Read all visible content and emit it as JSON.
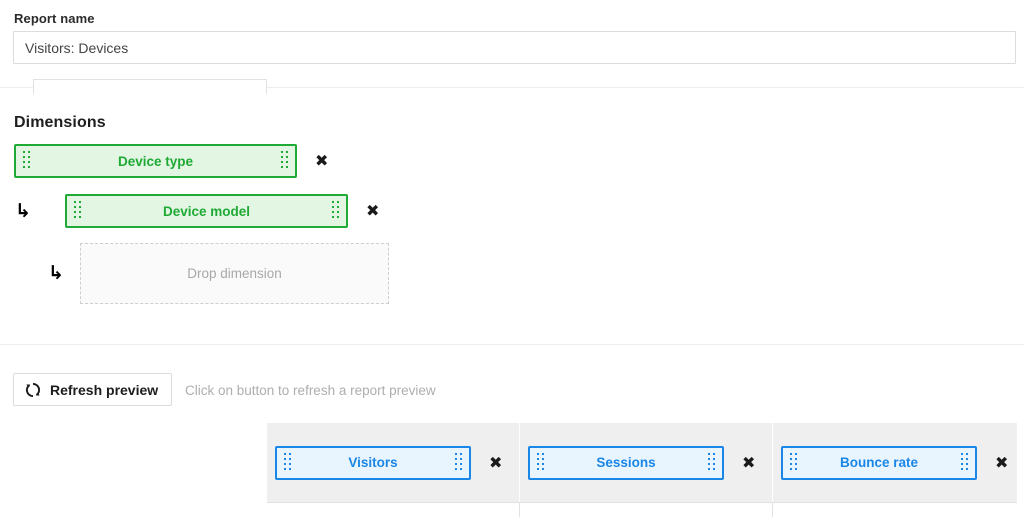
{
  "report_name": {
    "label": "Report name",
    "value": "Visitors: Devices",
    "placeholder": "Report name"
  },
  "dimensions": {
    "title": "Dimensions",
    "items": [
      {
        "label": "Device type",
        "remove": "✖",
        "nest_arrow": "↳",
        "level": 0
      },
      {
        "label": "Device model",
        "remove": "✖",
        "nest_arrow": "↳",
        "level": 1
      }
    ],
    "dropzone": {
      "label": "Drop dimension",
      "nest_arrow": "↳"
    }
  },
  "preview": {
    "refresh_label": "Refresh preview",
    "refresh_icon": "refresh-icon",
    "hint": "Click on button to refresh a report preview"
  },
  "metrics": {
    "items": [
      {
        "label": "Visitors",
        "remove": "✖"
      },
      {
        "label": "Sessions",
        "remove": "✖"
      },
      {
        "label": "Bounce rate",
        "remove": "✖"
      }
    ]
  },
  "colors": {
    "dimension_accent": "#1faa35",
    "dimension_fill": "#e3f5e3",
    "metric_accent": "#1a86e8",
    "metric_fill": "#e8f5fe",
    "table_header_bg": "#efefef",
    "muted_text": "#aeaeae"
  }
}
